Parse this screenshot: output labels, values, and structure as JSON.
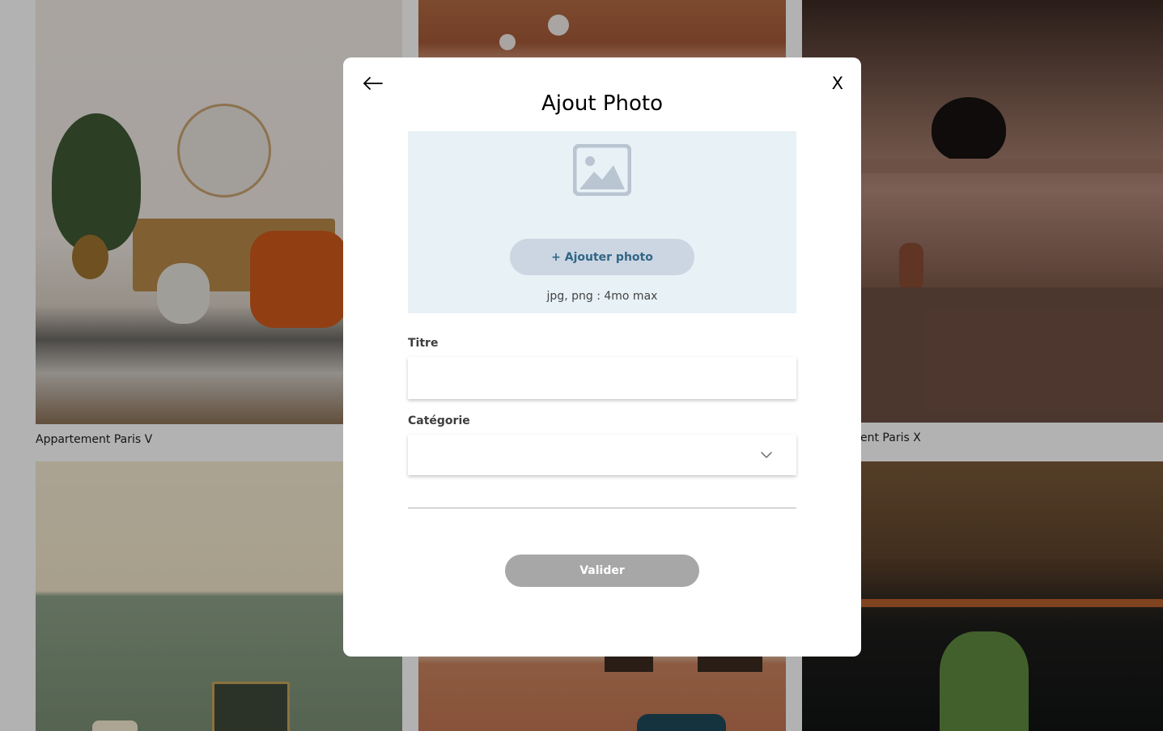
{
  "gallery": {
    "captions": {
      "left": "Appartement Paris V",
      "right_partial": "ent Paris X"
    }
  },
  "modal": {
    "title": "Ajout Photo",
    "close_label": "X",
    "back_icon": "arrow-left-icon",
    "upload": {
      "icon": "image-placeholder-icon",
      "button_label": "+ Ajouter photo",
      "hint": "jpg, png : 4mo max"
    },
    "title_field": {
      "label": "Titre",
      "value": ""
    },
    "category_field": {
      "label": "Catégorie",
      "value": ""
    },
    "submit_label": "Valider"
  },
  "colors": {
    "upload_background": "#e8f1f6",
    "add_photo_button": "#cbd6e2",
    "add_photo_text": "#306685",
    "submit_disabled": "#a7a7a7",
    "overlay": "rgba(0,0,0,0.30)"
  }
}
